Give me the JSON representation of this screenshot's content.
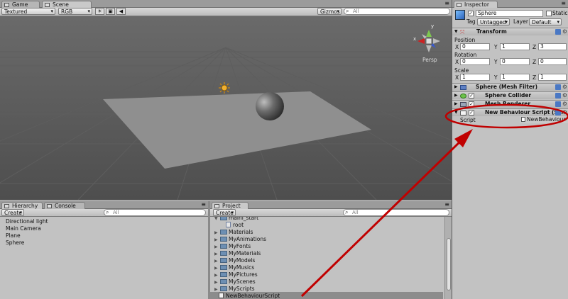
{
  "game_tab": "Game",
  "scene_tab": "Scene",
  "scene_toolbar": {
    "render_mode": "Textured",
    "color_mode": "RGB",
    "gizmos": "Gizmos",
    "search_placeholder": "All"
  },
  "scene_view": {
    "projection": "Persp",
    "axis_y": "y",
    "axis_x": "x"
  },
  "hierarchy": {
    "tab": "Hierarchy",
    "console_tab": "Console",
    "create": "Create",
    "search_placeholder": "All",
    "items": [
      "Directional light",
      "Main Camera",
      "Plane",
      "Sphere"
    ]
  },
  "project": {
    "tab": "Project",
    "create": "Create",
    "search_placeholder": "All",
    "items": [
      "maini_start",
      "root",
      "Materials",
      "MyAnimations",
      "MyFonts",
      "MyMaterials",
      "MyModels",
      "MyMusics",
      "MyPictures",
      "MyScenes",
      "MyScripts",
      "NewBehaviourScript"
    ]
  },
  "inspector": {
    "tab": "Inspector",
    "object_name": "Sphere",
    "static_label": "Static",
    "tag_label": "Tag",
    "tag_value": "Untagged",
    "layer_label": "Layer",
    "layer_value": "Default",
    "transform": {
      "title": "Transform",
      "position_label": "Position",
      "rotation_label": "Rotation",
      "scale_label": "Scale",
      "x": "X",
      "y": "Y",
      "z": "Z",
      "position": [
        "0",
        "1",
        "3"
      ],
      "rotation": [
        "0",
        "0",
        "0"
      ],
      "scale": [
        "1",
        "1",
        "1"
      ]
    },
    "components": [
      "Sphere (Mesh Filter)",
      "Sphere Collider",
      "Mesh Renderer",
      "New Behaviour Script (Scr"
    ],
    "script_label": "Script",
    "script_value": "NewBehaviour"
  },
  "colors": {
    "annotation": "#c00000",
    "selection": "#3b6fd8",
    "panel": "#c2c2c2"
  }
}
